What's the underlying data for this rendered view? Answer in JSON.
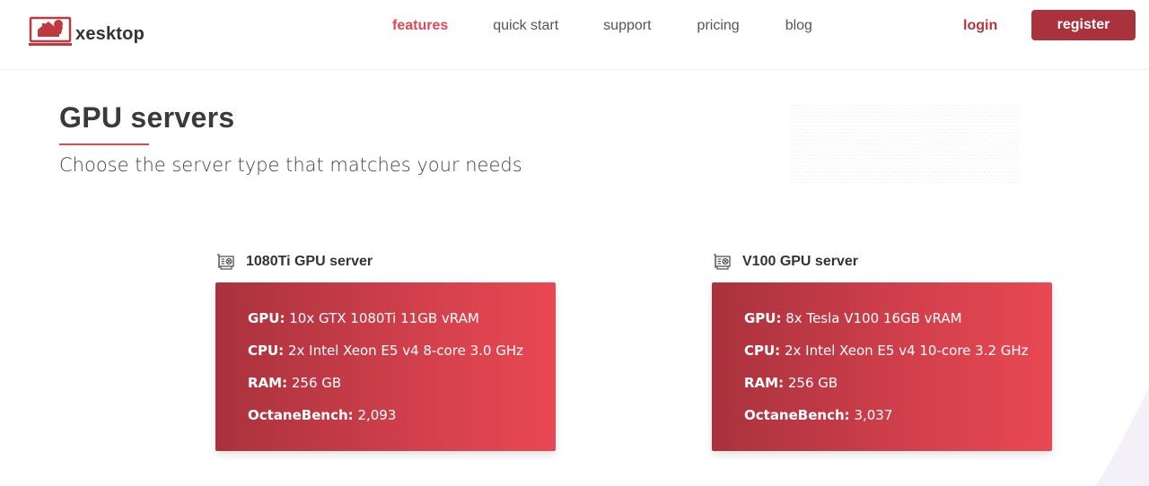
{
  "header": {
    "logo_text": "xesktop",
    "nav": [
      {
        "label": "features",
        "active": true
      },
      {
        "label": "quick start",
        "active": false
      },
      {
        "label": "support",
        "active": false
      },
      {
        "label": "pricing",
        "active": false
      },
      {
        "label": "blog",
        "active": false
      }
    ],
    "login_label": "login",
    "register_label": "register"
  },
  "hero": {
    "title": "GPU servers",
    "subtitle": "Choose the server type that matches your needs"
  },
  "servers": [
    {
      "name": "1080Ti GPU server",
      "specs": [
        {
          "key": "GPU:",
          "value": "10x GTX 1080Ti 11GB vRAM"
        },
        {
          "key": "CPU:",
          "value": "2x Intel Xeon E5 v4 8-core 3.0 GHz"
        },
        {
          "key": "RAM:",
          "value": "256 GB"
        },
        {
          "key": "OctaneBench:",
          "value": "2,093"
        }
      ]
    },
    {
      "name": "V100 GPU server",
      "specs": [
        {
          "key": "GPU:",
          "value": "8x Tesla V100 16GB vRAM"
        },
        {
          "key": "CPU:",
          "value": "2x Intel Xeon E5 v4 10-core 3.2 GHz"
        },
        {
          "key": "RAM:",
          "value": "256 GB"
        },
        {
          "key": "OctaneBench:",
          "value": "3,037"
        }
      ]
    }
  ],
  "colors": {
    "accent": "#e04856",
    "brand_dark": "#a9323d",
    "card_gradient_start": "#a9323d",
    "card_gradient_end": "#e84853"
  },
  "icons": [
    "xesktop-logo-icon",
    "gpu-card-icon"
  ]
}
